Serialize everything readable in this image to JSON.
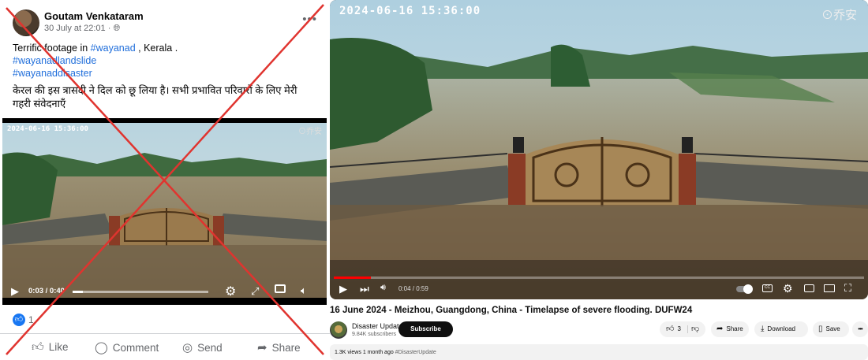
{
  "facebook_post": {
    "author": "Goutam Venkataram",
    "date": "30 July at 22:01",
    "privacy_icon": "globe-icon",
    "caption_prefix": "Terrific footage in ",
    "caption_tag": "#wayanad",
    "caption_suffix": " , Kerala .",
    "hashtags": [
      "#wayanadlandslide",
      "#wayanaddisaster"
    ],
    "hindi_text": "केरल की इस त्रासदी ने दिल को छू लिया है। सभी प्रभावित परिवारों के लिए मेरी गहरी संवेदनाएँ",
    "video": {
      "timestamp": "2024-06-16 15:36:00",
      "watermark": "⊙乔安",
      "time": "0:03 / 0:40",
      "progress": 0.075
    },
    "reaction_count": "1",
    "actions": [
      "Like",
      "Comment",
      "Send",
      "Share"
    ],
    "overlay_color": "#e0342f"
  },
  "youtube": {
    "video": {
      "timestamp": "2024-06-16 15:36:00",
      "watermark": "⊙乔安",
      "time": "0:04 / 0:59",
      "progress": 0.07
    },
    "title": "16 June 2024 - Meizhou, Guangdong, China - Timelapse of severe flooding. DUFW24",
    "channel_name": "Disaster Update",
    "subscribers": "9.84K subscribers",
    "subscribe_label": "Subscribe",
    "like_count": "3",
    "share_label": "Share",
    "download_label": "Download",
    "save_label": "Save",
    "views": "1.3K views",
    "uploaded": "1 month ago",
    "hashtag": "#DisasterUpdate",
    "accent": "#ff0000"
  }
}
